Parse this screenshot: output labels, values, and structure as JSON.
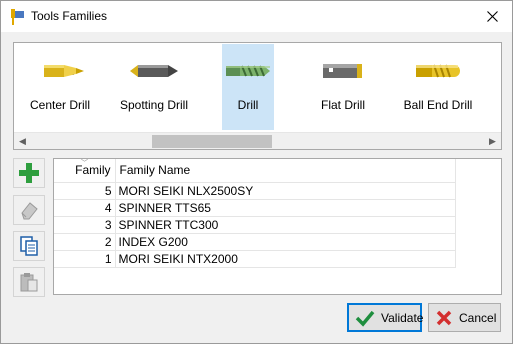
{
  "window": {
    "title": "Tools Families"
  },
  "families": [
    {
      "label": "Center Drill",
      "icon": "center-drill-icon",
      "selected": false
    },
    {
      "label": "Spotting Drill",
      "icon": "spotting-drill-icon",
      "selected": false
    },
    {
      "label": "Drill",
      "icon": "drill-icon",
      "selected": true
    },
    {
      "label": "Flat Drill",
      "icon": "flat-drill-icon",
      "selected": false
    },
    {
      "label": "Ball End Drill",
      "icon": "ball-end-drill-icon",
      "selected": false
    }
  ],
  "table": {
    "columns": [
      "Family",
      "Family Name"
    ],
    "rows": [
      {
        "family": "5",
        "name": "MORI SEIKI NLX2500SY"
      },
      {
        "family": "4",
        "name": "SPINNER TTS65"
      },
      {
        "family": "3",
        "name": "SPINNER TTC300"
      },
      {
        "family": "2",
        "name": "INDEX G200"
      },
      {
        "family": "1",
        "name": "MORI SEIKI NTX2000"
      }
    ]
  },
  "toolbar": {
    "add": "plus-icon",
    "erase": "eraser-icon",
    "copy": "copy-icon",
    "paste": "paste-icon"
  },
  "buttons": {
    "validate": "Validate",
    "cancel": "Cancel"
  },
  "colors": {
    "selected": "#cce4f7",
    "accent": "#0078d7",
    "validate_check": "#1e8e3e",
    "cancel_x": "#d32f2f",
    "add_plus": "#2e9e3e"
  }
}
